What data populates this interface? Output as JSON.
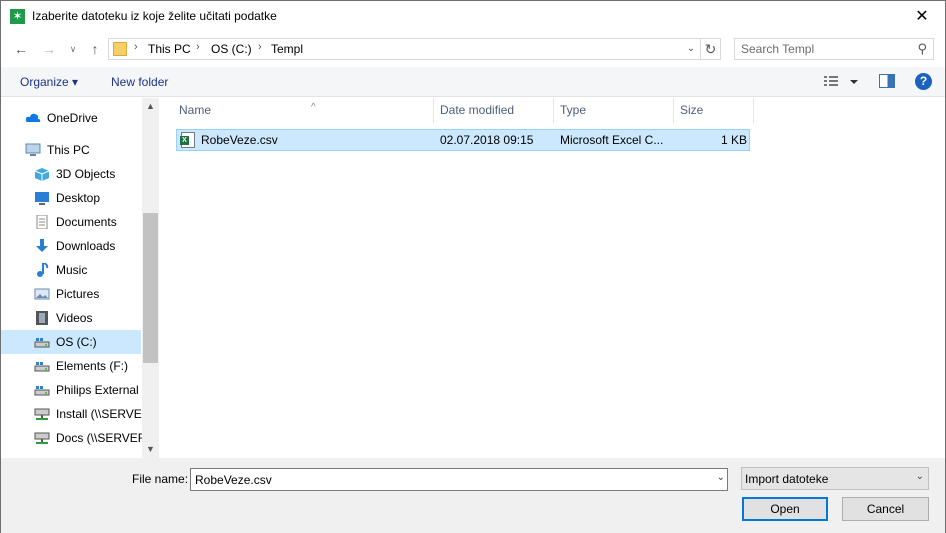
{
  "window": {
    "title": "Izaberite datoteku iz koje želite učitati podatke",
    "close_glyph": "✕"
  },
  "address": {
    "crumbs": [
      "This PC",
      "OS (C:)",
      "Templ"
    ],
    "search_placeholder": "Search Templ"
  },
  "toolbar": {
    "organize_label": "Organize ▾",
    "new_folder_label": "New folder",
    "help_glyph": "?"
  },
  "nav": {
    "items": [
      {
        "label": "OneDrive",
        "icon": "cloud-icon",
        "color": "#0f7ae5"
      },
      {
        "label": "This PC",
        "icon": "computer-icon",
        "color": "#5a87b8"
      },
      {
        "label": "3D Objects",
        "icon": "cube-icon",
        "color": "#3fa9e0"
      },
      {
        "label": "Desktop",
        "icon": "desktop-icon",
        "color": "#2a7fd4"
      },
      {
        "label": "Documents",
        "icon": "document-icon",
        "color": "#8a8a8a"
      },
      {
        "label": "Downloads",
        "icon": "download-icon",
        "color": "#2a7fd4"
      },
      {
        "label": "Music",
        "icon": "music-icon",
        "color": "#2a7fd4"
      },
      {
        "label": "Pictures",
        "icon": "pictures-icon",
        "color": "#6b8bb0"
      },
      {
        "label": "Videos",
        "icon": "videos-icon",
        "color": "#555555"
      },
      {
        "label": "OS (C:)",
        "icon": "drive-icon",
        "color": "#555555"
      },
      {
        "label": "Elements (F:)",
        "icon": "drive-icon",
        "color": "#555555"
      },
      {
        "label": "Philips External H",
        "icon": "drive-icon",
        "color": "#555555"
      },
      {
        "label": "Install (\\\\SERVER",
        "icon": "network-drive-icon",
        "color": "#555555"
      },
      {
        "label": "Docs (\\\\SERVER-",
        "icon": "network-drive-icon",
        "color": "#555555"
      }
    ],
    "selected_index": 9
  },
  "filelist": {
    "columns": [
      "Name",
      "Date modified",
      "Type",
      "Size"
    ],
    "rows": [
      {
        "name": "RobeVeze.csv",
        "date": "02.07.2018 09:15",
        "type": "Microsoft Excel C...",
        "size": "1 KB"
      }
    ]
  },
  "bottom": {
    "file_name_label": "File name:",
    "file_name_value": "RobeVeze.csv",
    "filter_value": "Import datoteke",
    "open_label": "Open",
    "cancel_label": "Cancel"
  }
}
